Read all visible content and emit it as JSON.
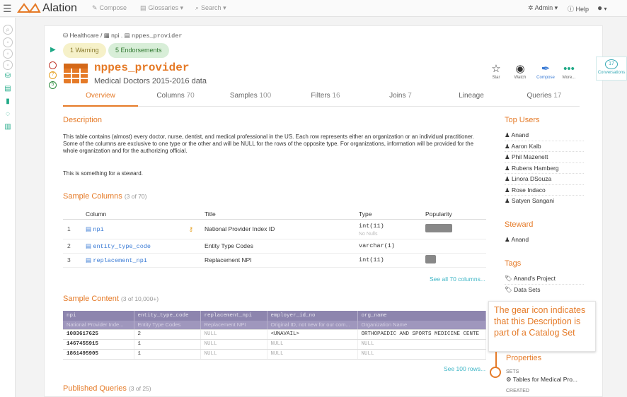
{
  "app": {
    "brand": "Alation"
  },
  "topnav": {
    "compose": "Compose",
    "glossaries": "Glossaries",
    "search": "Search",
    "admin": "Admin",
    "help": "Help"
  },
  "breadcrumb": {
    "schema_db": "Healthcare",
    "sep1": "/",
    "schema": "npi",
    "sep2": ".",
    "table": "nppes_provider"
  },
  "badges": {
    "warning": "1 Warning",
    "endorsements": "5 Endorsements"
  },
  "side_indicators": [
    "",
    "",
    "5"
  ],
  "table": {
    "name": "nppes_provider",
    "title": "Medical Doctors 2015-2016 data"
  },
  "actions": {
    "star": "Star",
    "watch": "Watch",
    "compose": "Compose",
    "more": "More..."
  },
  "tabs": [
    {
      "label": "Overview",
      "count": ""
    },
    {
      "label": "Columns",
      "count": "70"
    },
    {
      "label": "Samples",
      "count": "100"
    },
    {
      "label": "Filters",
      "count": "16"
    },
    {
      "label": "Joins",
      "count": "7"
    },
    {
      "label": "Lineage",
      "count": ""
    },
    {
      "label": "Queries",
      "count": "17"
    }
  ],
  "description": {
    "heading": "Description",
    "text": "This table contains (almost) every doctor, nurse, dentist, and medical professional in the US. Each row represents either an organization or an individual practitioner. Some of the columns are exclusive to one type or the other and will be NULL for the rows of the opposite type. For organizations, information will be provided for the whole organization and for the authorizing official.",
    "steward_note": "This is something for a steward."
  },
  "sample_columns": {
    "heading": "Sample Columns",
    "count": "(3 of 70)",
    "headers": {
      "column": "Column",
      "title": "Title",
      "type": "Type",
      "popularity": "Popularity"
    },
    "rows": [
      {
        "num": "1",
        "name": "npi",
        "title": "National Provider Index ID",
        "type": "int(11)",
        "note": "No Nulls",
        "popularity": 0.9,
        "key": true
      },
      {
        "num": "2",
        "name": "entity_type_code",
        "title": "Entity Type Codes",
        "type": "varchar(1)",
        "note": "",
        "popularity": 0,
        "key": false
      },
      {
        "num": "3",
        "name": "replacement_npi",
        "title": "Replacement NPI",
        "type": "int(11)",
        "note": "",
        "popularity": 0.35,
        "key": false
      }
    ],
    "see_all": "See all 70 columns..."
  },
  "sample_content": {
    "heading": "Sample Content",
    "count": "(3 of 10,000+)",
    "headers": [
      "npi",
      "entity_type_code",
      "replacement_npi",
      "employer_id_no",
      "org_name"
    ],
    "subheaders": [
      "National Provider Inde...",
      "Entity Type Codes",
      "Replacement NPI",
      "Original ID, not new for our com...",
      "Organization Name"
    ],
    "rows": [
      [
        "1083617625",
        "2",
        "NULL",
        "<UNAVAIL>",
        "ORTHOPAEDIC AND SPORTS MEDICINE CENTE"
      ],
      [
        "1467455915",
        "1",
        "NULL",
        "NULL",
        "NULL"
      ],
      [
        "1861495905",
        "1",
        "NULL",
        "NULL",
        "NULL"
      ]
    ],
    "see_rows": "See 100 rows..."
  },
  "published_queries": {
    "heading": "Published Queries",
    "count": "(3 of 25)"
  },
  "top_users": {
    "heading": "Top Users",
    "users": [
      "Anand",
      "Aaron Kalb",
      "Phil Mazenett",
      "Rubens Hamberg",
      "Linora DSouza",
      "Rose Indaco",
      "Satyen Sangani"
    ]
  },
  "steward": {
    "heading": "Steward",
    "name": "Anand"
  },
  "tags": {
    "heading": "Tags",
    "items": [
      "Anand's Project",
      "Data Sets"
    ]
  },
  "properties": {
    "heading": "Properties",
    "sets_label": "SETS",
    "set_item": "Tables for Medical Pro...",
    "created_label": "CREATED"
  },
  "conversations": {
    "count": "17",
    "label": "Conversations"
  },
  "callout": {
    "text": "The gear icon indicates that this Description is part of a Catalog Set"
  },
  "colors": {
    "accent": "#e57a27",
    "teal": "#20a987",
    "link": "#3a7bd5",
    "header_purple": "#8d85ae"
  }
}
